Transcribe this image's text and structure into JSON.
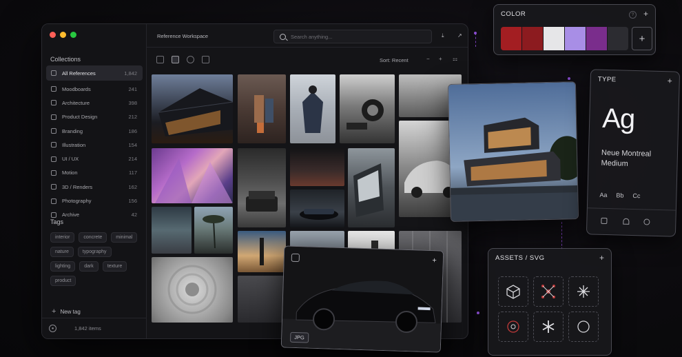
{
  "window": {
    "title": "Reference Workspace",
    "search_placeholder": "Search anything..."
  },
  "sidebar": {
    "collections_title": "Collections",
    "collections": [
      {
        "label": "All References",
        "count": "1,842",
        "active": true
      },
      {
        "label": "Moodboards",
        "count": "241"
      },
      {
        "label": "Architecture",
        "count": "398"
      },
      {
        "label": "Product Design",
        "count": "212"
      },
      {
        "label": "Branding",
        "count": "186"
      },
      {
        "label": "Illustration",
        "count": "154"
      },
      {
        "label": "UI / UX",
        "count": "214"
      },
      {
        "label": "Motion",
        "count": "117"
      },
      {
        "label": "3D / Renders",
        "count": "162"
      },
      {
        "label": "Photography",
        "count": "156"
      },
      {
        "label": "Archive",
        "count": "42"
      }
    ],
    "tags_title": "Tags",
    "tags": [
      "interior",
      "concrete",
      "minimal",
      "nature",
      "typography",
      "lighting",
      "dark",
      "texture",
      "product"
    ],
    "new_tag_label": "New tag",
    "footer_count": "1,842 items"
  },
  "toolbar": {
    "sort_label": "Sort: Recent"
  },
  "color_panel": {
    "title": "COLOR",
    "swatches": [
      "#a31e22",
      "#8c1b1f",
      "#e6e6e8",
      "#a88ee6",
      "#7a2d8c",
      "#2c2c31"
    ]
  },
  "type_panel": {
    "title": "TYPE",
    "sample": "Ag",
    "font_name": "Neue Montreal",
    "font_weight": "Medium",
    "glyphs": [
      "Aa",
      "Bb",
      "Cc"
    ]
  },
  "assets_panel": {
    "title": "ASSETS / SVG",
    "icons": [
      "cube-icon",
      "network-icon",
      "sparkle-icon",
      "face-circle-icon",
      "asterisk-icon",
      "circle-icon"
    ]
  },
  "car_card": {
    "badge": "JPG"
  }
}
